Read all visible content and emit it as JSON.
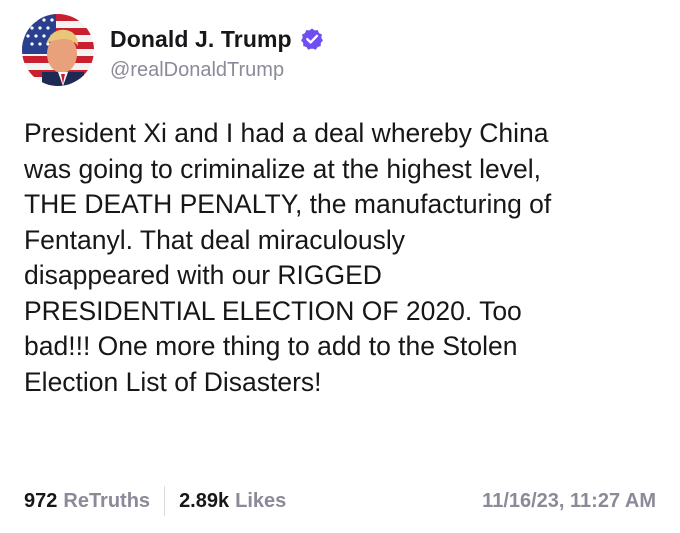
{
  "author": {
    "display_name": "Donald J. Trump",
    "handle": "@realDonaldTrump",
    "verified": true,
    "verified_color": "#6f4ff2",
    "avatar_icon": "profile-photo-flag-background"
  },
  "post": {
    "lines": [
      "President Xi and I had a deal whereby China",
      "was going to criminalize at the highest level,",
      "THE DEATH PENALTY, the manufacturing of",
      "Fentanyl. That deal miraculously",
      "disappeared with our RIGGED",
      "PRESIDENTIAL ELECTION OF 2020. Too",
      "bad!!! One more thing to add to the Stolen",
      "Election List of Disasters!"
    ]
  },
  "stats": {
    "retruths_count": "972",
    "retruths_label": "ReTruths",
    "likes_count": "2.89k",
    "likes_label": "Likes",
    "timestamp": "11/16/23, 11:27 AM"
  }
}
